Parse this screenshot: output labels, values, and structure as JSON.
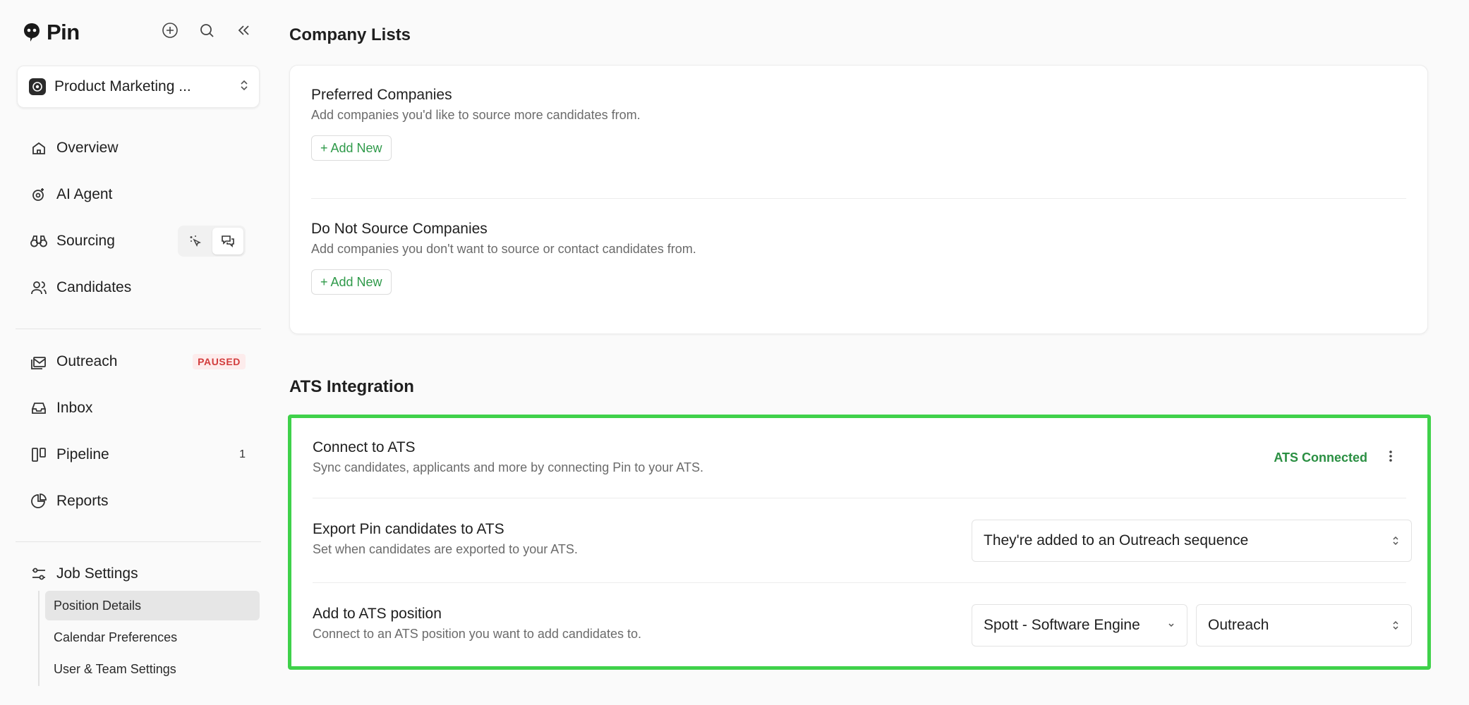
{
  "brand": {
    "name": "Pin"
  },
  "sidebar": {
    "project": "Product Marketing ...",
    "nav": [
      {
        "label": "Overview",
        "icon": "home-icon"
      },
      {
        "label": "AI Agent",
        "icon": "ai-agent-icon"
      },
      {
        "label": "Sourcing",
        "icon": "binoculars-icon"
      },
      {
        "label": "Candidates",
        "icon": "users-icon"
      }
    ],
    "nav2": [
      {
        "label": "Outreach",
        "icon": "mail-stack-icon",
        "badge": "PAUSED"
      },
      {
        "label": "Inbox",
        "icon": "inbox-icon"
      },
      {
        "label": "Pipeline",
        "icon": "kanban-icon",
        "count": "1"
      },
      {
        "label": "Reports",
        "icon": "pie-chart-icon"
      }
    ],
    "job_settings": {
      "label": "Job Settings",
      "items": [
        "Position Details",
        "Calendar Preferences",
        "User & Team Settings"
      ]
    }
  },
  "company_lists": {
    "title": "Company Lists",
    "preferred": {
      "title": "Preferred Companies",
      "desc": "Add companies you'd like to source more candidates from.",
      "button": "Add New"
    },
    "do_not_source": {
      "title": "Do Not Source Companies",
      "desc": "Add companies you don't want to source or contact candidates from.",
      "button": "Add New"
    }
  },
  "ats": {
    "title": "ATS Integration",
    "connect": {
      "title": "Connect to ATS",
      "desc": "Sync candidates, applicants and more by connecting Pin to your ATS.",
      "status": "ATS Connected"
    },
    "export": {
      "title": "Export Pin candidates to ATS",
      "desc": "Set when candidates are exported to your ATS.",
      "value": "They're added to an Outreach sequence"
    },
    "position": {
      "title": "Add to ATS position",
      "desc": "Connect to an ATS position you want to add candidates to.",
      "position_value": "Spott - Software Engine",
      "stage_value": "Outreach"
    }
  },
  "colors": {
    "accent_green": "#2f9a4a",
    "highlight": "#3fd14a",
    "paused": "#d23c3c"
  }
}
